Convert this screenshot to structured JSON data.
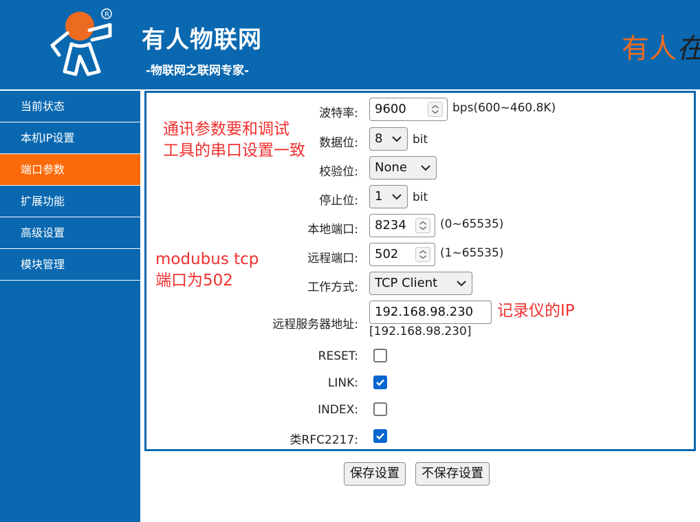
{
  "header": {
    "title": "有人物联网",
    "slogan": "-物联网之联网专家-",
    "deco_text": "有人",
    "deco_tail": "在"
  },
  "sidebar": {
    "items": [
      {
        "label": "当前状态"
      },
      {
        "label": "本机IP设置"
      },
      {
        "label": "端口参数",
        "active": true
      },
      {
        "label": "扩展功能"
      },
      {
        "label": "高级设置"
      },
      {
        "label": "模块管理"
      }
    ]
  },
  "form": {
    "baud_rate": {
      "label": "波特率:",
      "value": "9600",
      "unit": "bps(600~460.8K)"
    },
    "data_bits": {
      "label": "数据位:",
      "value": "8",
      "unit": "bit"
    },
    "parity": {
      "label": "校验位:",
      "value": "None"
    },
    "stop_bits": {
      "label": "停止位:",
      "value": "1",
      "unit": "bit"
    },
    "local_port": {
      "label": "本地端口:",
      "value": "8234",
      "range": "(0~65535)"
    },
    "remote_port": {
      "label": "远程端口:",
      "value": "502",
      "range": "(1~65535)"
    },
    "work_mode": {
      "label": "工作方式:",
      "value": "TCP Client"
    },
    "remote_server": {
      "label": "远程服务器地址:",
      "value": "192.168.98.230",
      "current": "[192.168.98.230]"
    },
    "reset": {
      "label": "RESET:",
      "checked": false
    },
    "link": {
      "label": "LINK:",
      "checked": true
    },
    "index": {
      "label": "INDEX:",
      "checked": false
    },
    "rfc2217": {
      "label": "类RFC2217:",
      "checked": true
    }
  },
  "annotations": {
    "serial_note_line1": "通讯参数要和调试",
    "serial_note_line2": "工具的串口设置一致",
    "port_note_line1": "modubus tcp",
    "port_note_line2": "端口为502",
    "ip_note": "记录仪的IP"
  },
  "buttons": {
    "save": "保存设置",
    "discard": "不保存设置"
  },
  "colors": {
    "brand_blue": "#0a68b0",
    "active_orange": "#fb6a0a",
    "annotation_red": "#f0302f",
    "checkbox_blue": "#0a66cf"
  }
}
